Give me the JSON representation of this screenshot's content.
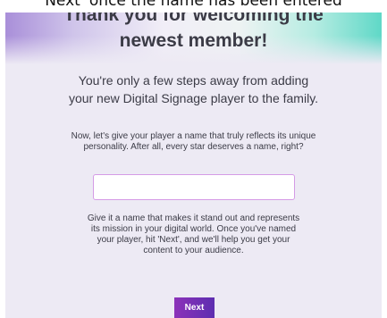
{
  "caption": "Next' once the name has been entered",
  "title_lines": [
    "Thank you for welcoming the",
    "newest member!"
  ],
  "intro_lines": [
    "You're only a few steps away from adding",
    "your new Digital Signage player to the family."
  ],
  "prompt_lines": [
    "Now, let's give your player a name that truly reflects its unique",
    "personality. After all, every star deserves a name, right?"
  ],
  "name_input": {
    "value": "",
    "placeholder": ""
  },
  "hint_lines": [
    "Give it a name that makes it stand out and represents",
    "its mission in your digital world. Once you've named",
    "your player, hit 'Next', and we'll help you get your",
    "content to your audience."
  ],
  "next_button": {
    "label": "Next"
  },
  "colors": {
    "accent_purple": "#8c32b9",
    "accent_teal": "#5fd8c7",
    "card_background": "#edeaf4",
    "input_border": "#d59be6",
    "text": "#3b3b46"
  }
}
